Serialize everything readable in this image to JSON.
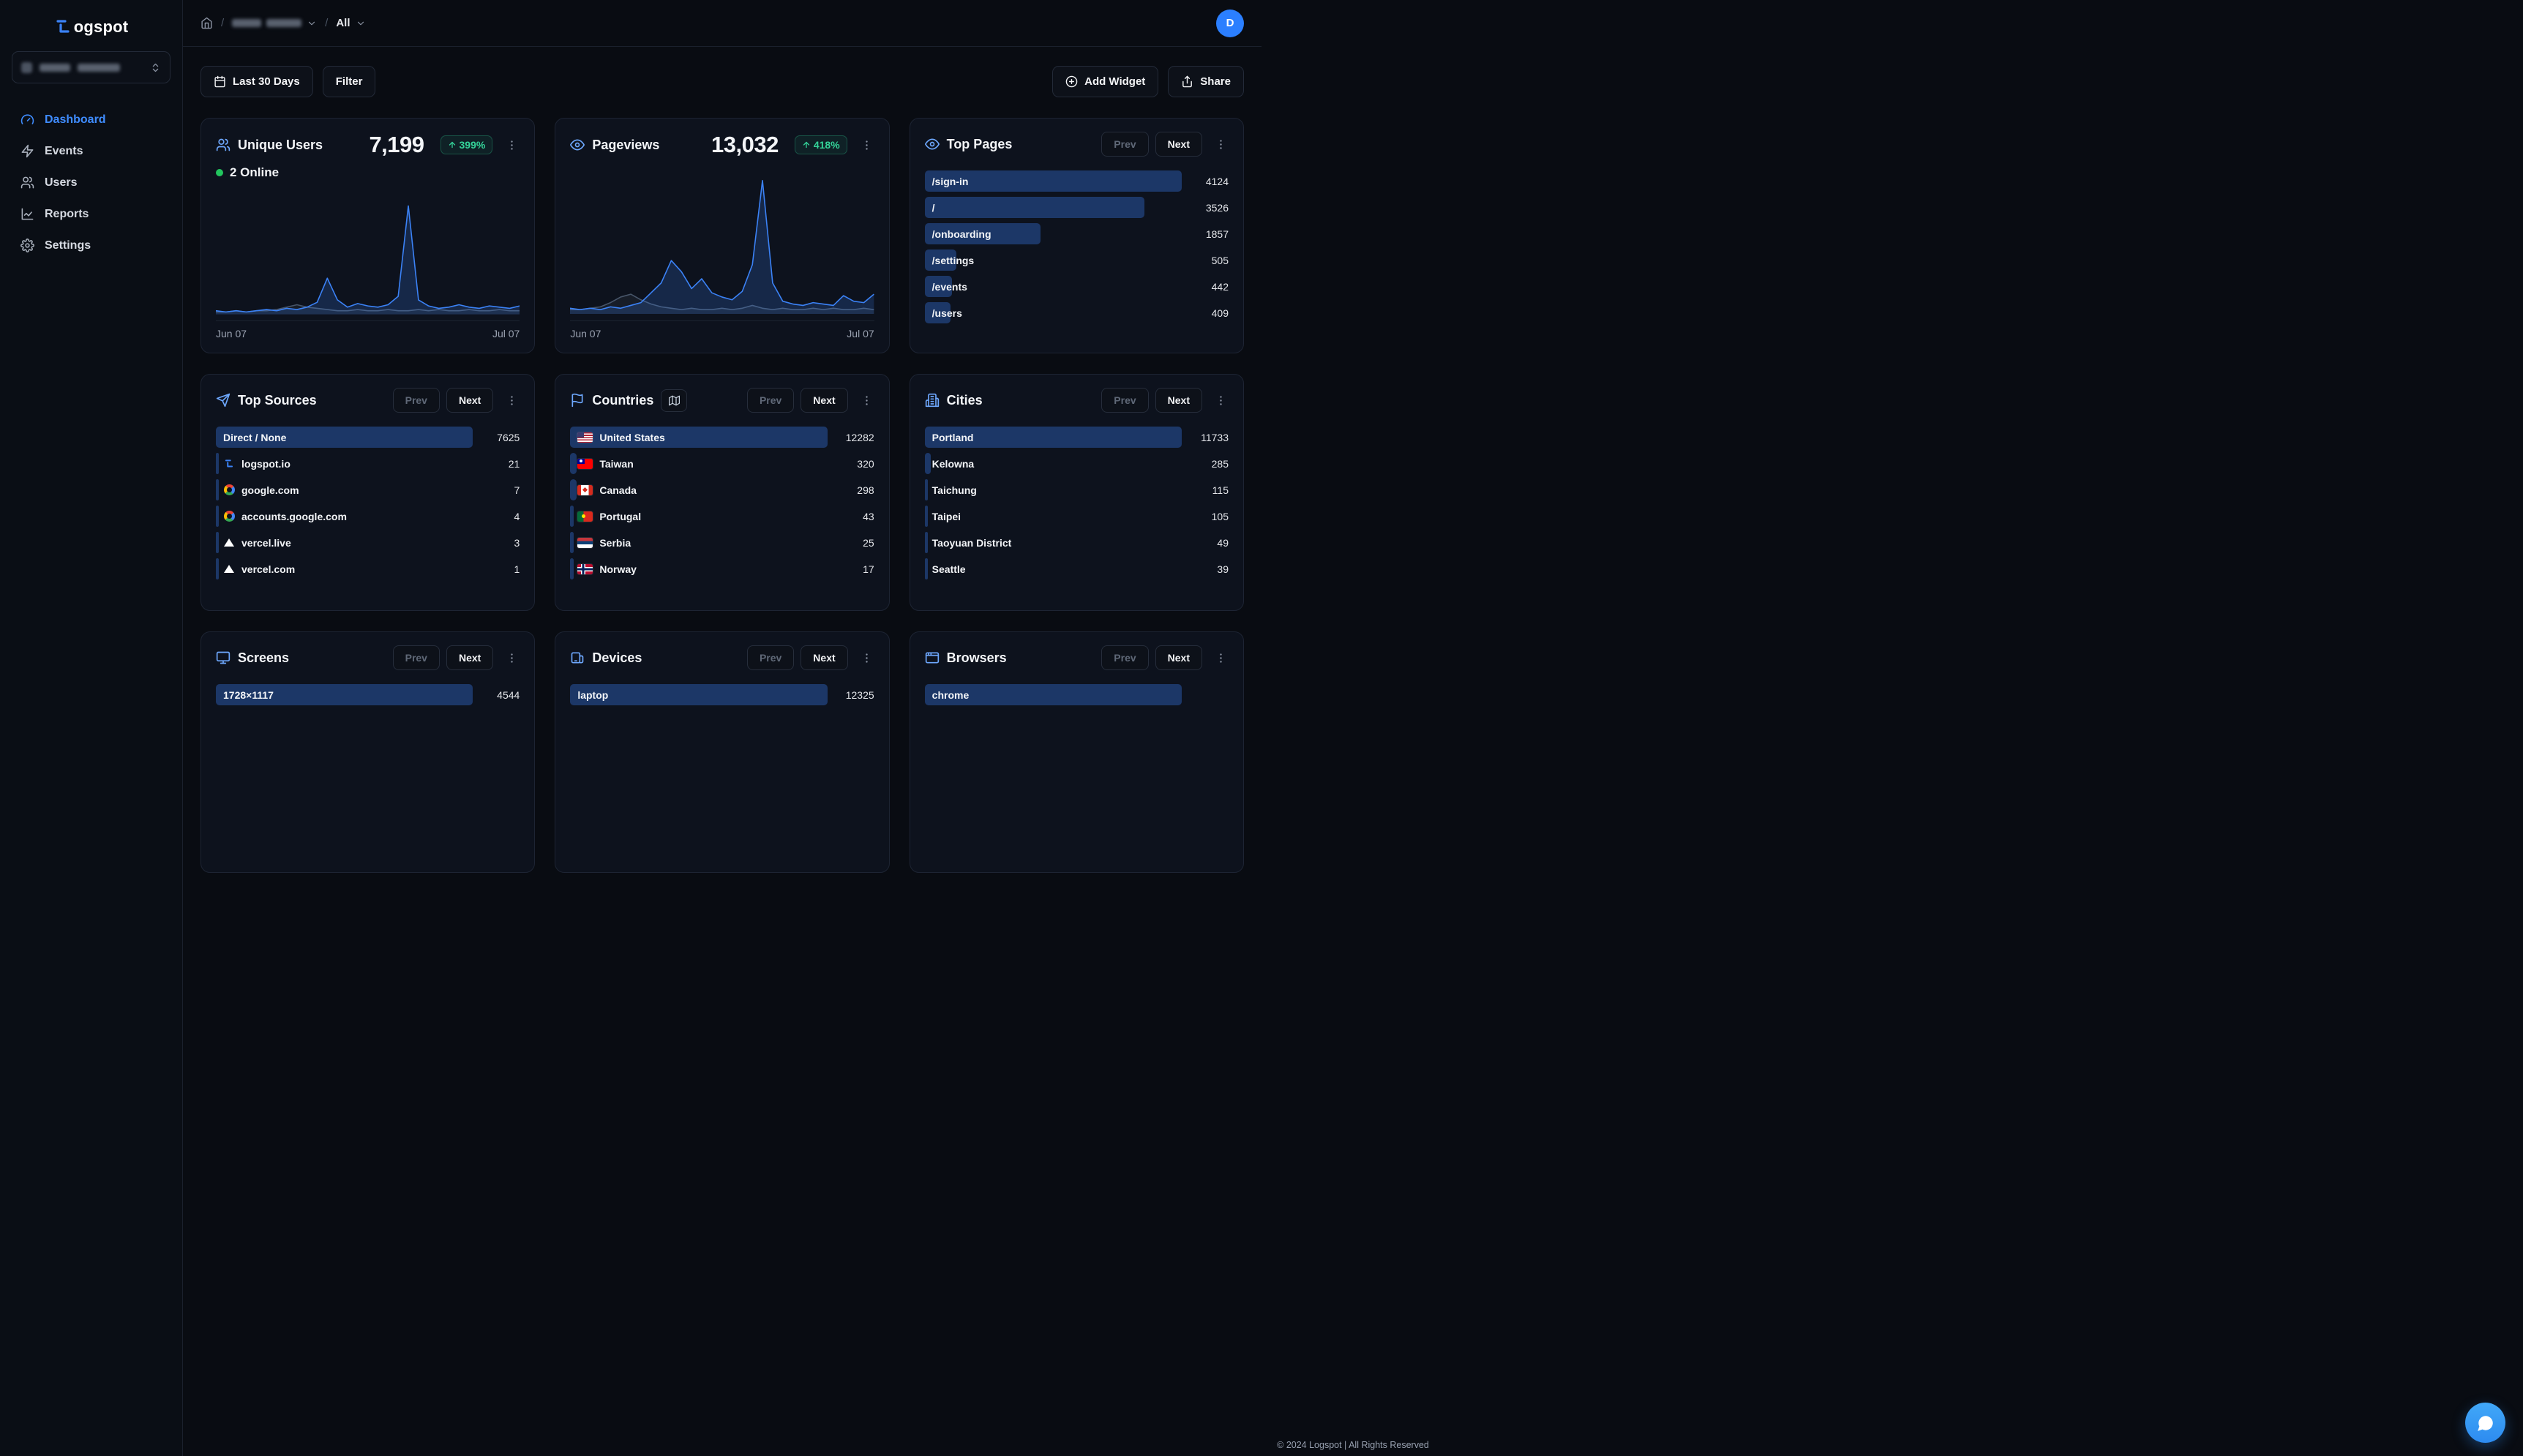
{
  "brand": {
    "logo_text": "ogspot"
  },
  "sidebar": {
    "nav": [
      {
        "label": "Dashboard",
        "active": true
      },
      {
        "label": "Events"
      },
      {
        "label": "Users"
      },
      {
        "label": "Reports"
      },
      {
        "label": "Settings"
      }
    ]
  },
  "header": {
    "breadcrumb": {
      "scope": "All"
    },
    "avatar_initial": "D"
  },
  "toolbar": {
    "date_range_label": "Last 30 Days",
    "filter_label": "Filter",
    "add_widget_label": "Add Widget",
    "share_label": "Share"
  },
  "pager": {
    "prev_label": "Prev",
    "next_label": "Next"
  },
  "cards": {
    "unique_users": {
      "title": "Unique Users",
      "value": "7,199",
      "change_pct": "399%",
      "online_label": "2 Online",
      "x_start": "Jun 07",
      "x_end": "Jul 07"
    },
    "pageviews": {
      "title": "Pageviews",
      "value": "13,032",
      "change_pct": "418%",
      "x_start": "Jun 07",
      "x_end": "Jul 07"
    },
    "top_pages": {
      "title": "Top Pages",
      "items": [
        {
          "label": "/sign-in",
          "value": 4124
        },
        {
          "label": "/",
          "value": 3526
        },
        {
          "label": "/onboarding",
          "value": 1857
        },
        {
          "label": "/settings",
          "value": 505
        },
        {
          "label": "/events",
          "value": 442
        },
        {
          "label": "/users",
          "value": 409
        }
      ]
    },
    "top_sources": {
      "title": "Top Sources",
      "items": [
        {
          "label": "Direct / None",
          "value": 7625,
          "icon": "none"
        },
        {
          "label": "logspot.io",
          "value": 21,
          "icon": "logspot-favicon"
        },
        {
          "label": "google.com",
          "value": 7,
          "icon": "google-favicon"
        },
        {
          "label": "accounts.google.com",
          "value": 4,
          "icon": "google-favicon"
        },
        {
          "label": "vercel.live",
          "value": 3,
          "icon": "vercel-favicon"
        },
        {
          "label": "vercel.com",
          "value": 1,
          "icon": "vercel-favicon"
        }
      ]
    },
    "countries": {
      "title": "Countries",
      "items": [
        {
          "label": "United States",
          "value": 12282,
          "flag": "us"
        },
        {
          "label": "Taiwan",
          "value": 320,
          "flag": "tw"
        },
        {
          "label": "Canada",
          "value": 298,
          "flag": "ca"
        },
        {
          "label": "Portugal",
          "value": 43,
          "flag": "pt"
        },
        {
          "label": "Serbia",
          "value": 25,
          "flag": "rs"
        },
        {
          "label": "Norway",
          "value": 17,
          "flag": "no"
        }
      ]
    },
    "cities": {
      "title": "Cities",
      "items": [
        {
          "label": "Portland",
          "value": 11733
        },
        {
          "label": "Kelowna",
          "value": 285
        },
        {
          "label": "Taichung",
          "value": 115
        },
        {
          "label": "Taipei",
          "value": 105
        },
        {
          "label": "Taoyuan District",
          "value": 49
        },
        {
          "label": "Seattle",
          "value": 39
        }
      ]
    },
    "screens": {
      "title": "Screens",
      "items": [
        {
          "label": "1728×1117",
          "value": 4544
        }
      ]
    },
    "devices": {
      "title": "Devices",
      "items": [
        {
          "label": "laptop",
          "value": 12325
        }
      ]
    },
    "browsers": {
      "title": "Browsers",
      "items": [
        {
          "label": "chrome",
          "value": "",
          "bar_pct": 100
        }
      ]
    }
  },
  "footer": {
    "copyright": "© 2024 Logspot | All Rights Reserved"
  },
  "colors": {
    "accent": "#3b82f6",
    "positive": "#34d399",
    "bar_fill": "#1c3767",
    "online": "#22c55e"
  },
  "chart_data": [
    {
      "type": "area",
      "title": "Unique Users",
      "x_axis": {
        "start": "Jun 07",
        "end": "Jul 07"
      },
      "ylim": [
        0,
        100
      ],
      "grid": false,
      "legend": "none",
      "series": [
        {
          "name": "unique-users",
          "color": "#3b82f6",
          "fill": "rgba(59,130,246,0.20)",
          "values": [
            3,
            2,
            3,
            2,
            3,
            4,
            3,
            5,
            4,
            6,
            10,
            30,
            12,
            6,
            9,
            7,
            6,
            8,
            15,
            90,
            12,
            7,
            5,
            6,
            8,
            6,
            5,
            7,
            6,
            5,
            7
          ]
        },
        {
          "name": "previous-period",
          "color": "#475569",
          "fill": "rgba(148,163,184,0.08)",
          "values": [
            2,
            2,
            3,
            2,
            3,
            3,
            4,
            6,
            8,
            6,
            5,
            4,
            3,
            3,
            4,
            3,
            3,
            4,
            3,
            3,
            4,
            3,
            4,
            3,
            3,
            4,
            3,
            3,
            4,
            3,
            3
          ]
        }
      ]
    },
    {
      "type": "area",
      "title": "Pageviews",
      "x_axis": {
        "start": "Jun 07",
        "end": "Jul 07"
      },
      "ylim": [
        0,
        100
      ],
      "grid": false,
      "legend": "none",
      "series": [
        {
          "name": "pageviews",
          "color": "#3b82f6",
          "fill": "rgba(59,130,246,0.20)",
          "values": [
            4,
            3,
            4,
            3,
            5,
            4,
            6,
            8,
            15,
            22,
            38,
            30,
            18,
            25,
            15,
            12,
            10,
            16,
            35,
            95,
            22,
            9,
            7,
            6,
            8,
            7,
            6,
            13,
            9,
            8,
            14
          ]
        },
        {
          "name": "previous-period",
          "color": "#475569",
          "fill": "rgba(148,163,184,0.08)",
          "values": [
            3,
            3,
            4,
            5,
            8,
            12,
            14,
            10,
            7,
            5,
            4,
            3,
            4,
            3,
            3,
            4,
            3,
            4,
            6,
            4,
            3,
            4,
            3,
            3,
            4,
            3,
            4,
            3,
            3,
            4,
            3
          ]
        }
      ]
    }
  ]
}
